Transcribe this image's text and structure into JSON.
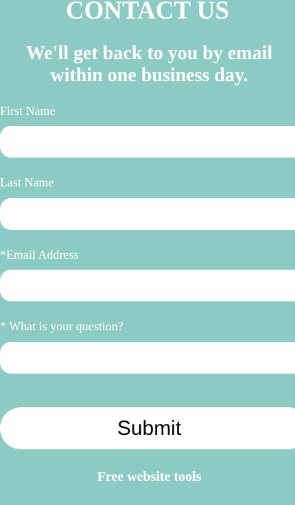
{
  "header": {
    "title": "CONTACT US",
    "subtitle": "We'll get back to you by email within one business day."
  },
  "form": {
    "first_name": {
      "label": "First Name",
      "value": "",
      "placeholder": ""
    },
    "last_name": {
      "label": "Last Name",
      "value": "",
      "placeholder": ""
    },
    "email": {
      "label": "*Email Address",
      "value": "",
      "placeholder": ""
    },
    "question": {
      "label": "* What is your question?",
      "value": "",
      "placeholder": ""
    },
    "submit_label": "Submit"
  },
  "footer": {
    "link_text": "Free website tools"
  },
  "colors": {
    "background": "#8ccbc3",
    "field": "#ffffff",
    "text": "#ffffff"
  }
}
